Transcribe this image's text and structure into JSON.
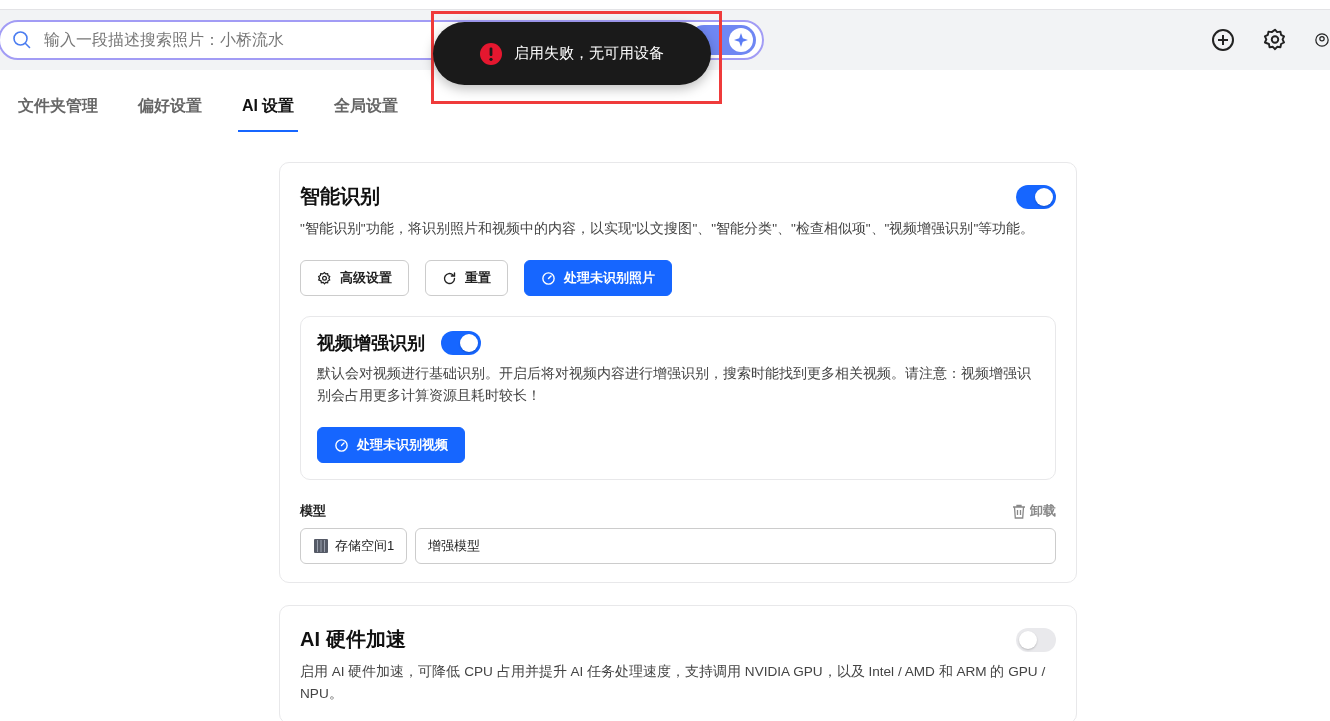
{
  "search": {
    "placeholder": "输入一段描述搜索照片：小桥流水"
  },
  "toast": {
    "message": "启用失败，无可用设备"
  },
  "tabs": [
    {
      "label": "文件夹管理",
      "selected": false
    },
    {
      "label": "偏好设置",
      "selected": false
    },
    {
      "label": "AI 设置",
      "selected": true
    },
    {
      "label": "全局设置",
      "selected": false
    }
  ],
  "smart_recognition": {
    "title": "智能识别",
    "on": true,
    "description": "\"智能识别\"功能，将识别照片和视频中的内容，以实现\"以文搜图\"、\"智能分类\"、\"检查相似项\"、\"视频增强识别\"等功能。",
    "buttons": [
      {
        "kind": "gear",
        "label": "高级设置",
        "primary": false
      },
      {
        "kind": "reset",
        "label": "重置",
        "primary": false
      },
      {
        "kind": "process",
        "label": "处理未识别照片",
        "primary": true
      }
    ],
    "video": {
      "title": "视频增强识别",
      "on": true,
      "description": "默认会对视频进行基础识别。开启后将对视频内容进行增强识别，搜索时能找到更多相关视频。请注意：视频增强识别会占用更多计算资源且耗时较长！",
      "button": "处理未识别视频"
    },
    "model": {
      "label": "模型",
      "unload": "卸载",
      "storage": "存储空间1",
      "value": "增强模型"
    }
  },
  "hardware": {
    "title": "AI 硬件加速",
    "on": false,
    "description": "启用 AI 硬件加速，可降低 CPU 占用并提升 AI 任务处理速度，支持调用 NVIDIA GPU，以及 Intel / AMD 和 ARM 的 GPU / NPU。"
  }
}
